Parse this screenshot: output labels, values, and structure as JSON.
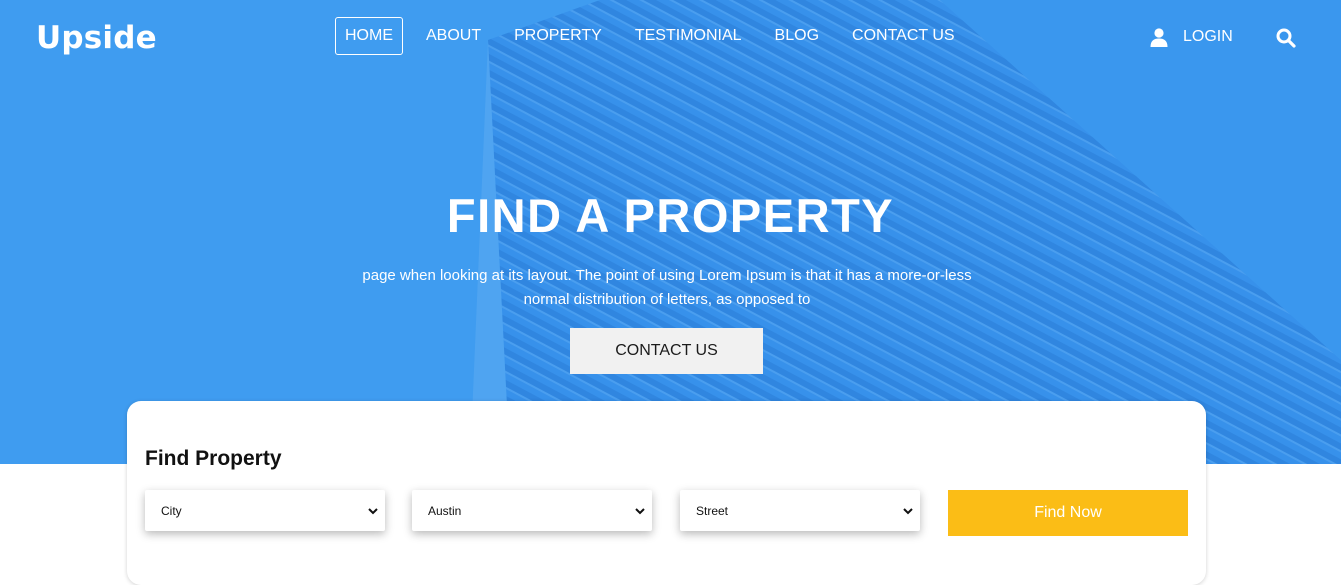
{
  "brand": {
    "name": "Upside"
  },
  "nav": {
    "items": [
      {
        "label": "HOME",
        "active": true
      },
      {
        "label": "ABOUT"
      },
      {
        "label": "PROPERTY"
      },
      {
        "label": "TESTIMONIAL"
      },
      {
        "label": "BLOG"
      },
      {
        "label": "CONTACT US"
      }
    ],
    "login_label": "LOGIN",
    "login_icon": "user-icon",
    "search_icon": "search-icon"
  },
  "hero": {
    "title": "FIND A PROPERTY",
    "text": "page when looking at its layout. The point of using Lorem Ipsum is that it has a more-or-less normal distribution of letters, as opposed to",
    "cta_label": "CONTACT US"
  },
  "search": {
    "title": "Find Property",
    "selects": [
      {
        "value": "City"
      },
      {
        "value": "Austin"
      },
      {
        "value": "Street"
      }
    ],
    "button_label": "Find Now"
  },
  "colors": {
    "hero_blue": "#3f9cf0",
    "accent_yellow": "#fbbd16",
    "white": "#ffffff"
  }
}
